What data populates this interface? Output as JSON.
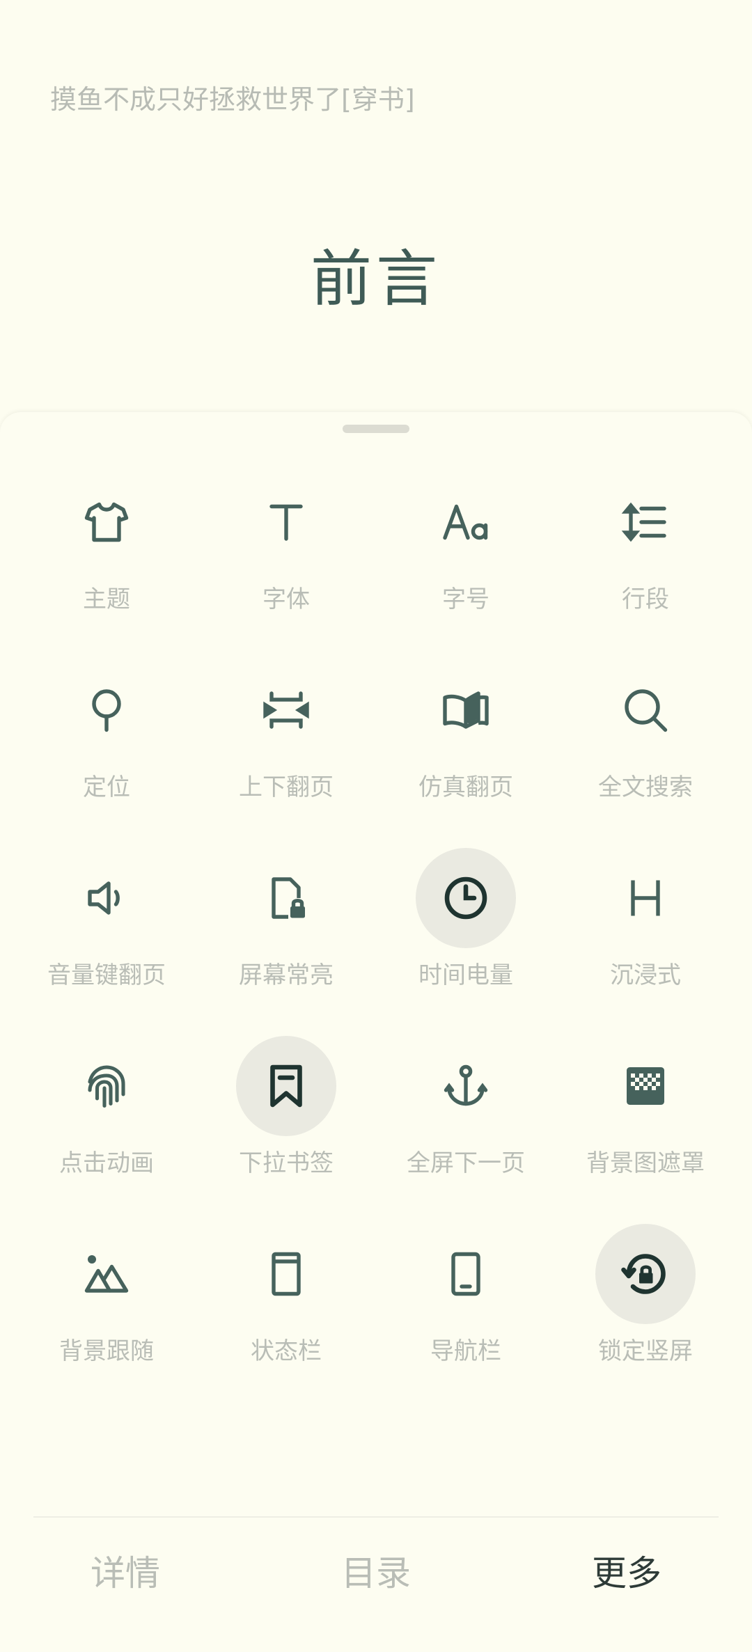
{
  "reader": {
    "book_title": "摸鱼不成只好拯救世界了[穿书]",
    "chapter_title": "前言"
  },
  "settings_menu": {
    "items": [
      {
        "label": "主题",
        "icon": "tshirt-icon",
        "active": false
      },
      {
        "label": "字体",
        "icon": "font-t-icon",
        "active": false
      },
      {
        "label": "字号",
        "icon": "font-size-icon",
        "active": false
      },
      {
        "label": "行段",
        "icon": "line-spacing-icon",
        "active": false
      },
      {
        "label": "定位",
        "icon": "pin-icon",
        "active": false
      },
      {
        "label": "上下翻页",
        "icon": "vertical-scroll-icon",
        "active": false
      },
      {
        "label": "仿真翻页",
        "icon": "book-page-curl-icon",
        "active": false
      },
      {
        "label": "全文搜索",
        "icon": "search-icon",
        "active": false
      },
      {
        "label": "音量键翻页",
        "icon": "volume-icon",
        "active": false
      },
      {
        "label": "屏幕常亮",
        "icon": "screen-lock-icon",
        "active": false
      },
      {
        "label": "时间电量",
        "icon": "clock-icon",
        "active": true
      },
      {
        "label": "沉浸式",
        "icon": "h-icon",
        "active": false
      },
      {
        "label": "点击动画",
        "icon": "fingerprint-icon",
        "active": false
      },
      {
        "label": "下拉书签",
        "icon": "bookmark-icon",
        "active": true
      },
      {
        "label": "全屏下一页",
        "icon": "anchor-icon",
        "active": false
      },
      {
        "label": "背景图遮罩",
        "icon": "checkerboard-icon",
        "active": false
      },
      {
        "label": "背景跟随",
        "icon": "landscape-icon",
        "active": false
      },
      {
        "label": "状态栏",
        "icon": "status-bar-icon",
        "active": false
      },
      {
        "label": "导航栏",
        "icon": "navigation-bar-icon",
        "active": false
      },
      {
        "label": "锁定竖屏",
        "icon": "rotation-lock-icon",
        "active": true
      }
    ]
  },
  "bottom_tabs": [
    {
      "label": "详情",
      "selected": false
    },
    {
      "label": "目录",
      "selected": false
    },
    {
      "label": "更多",
      "selected": true
    }
  ],
  "colors": {
    "background": "#fdfdf0",
    "icon": "#46625c",
    "icon_active": "#1f3430",
    "label": "#b9bdb6",
    "active_circle": "#eaeae1"
  }
}
